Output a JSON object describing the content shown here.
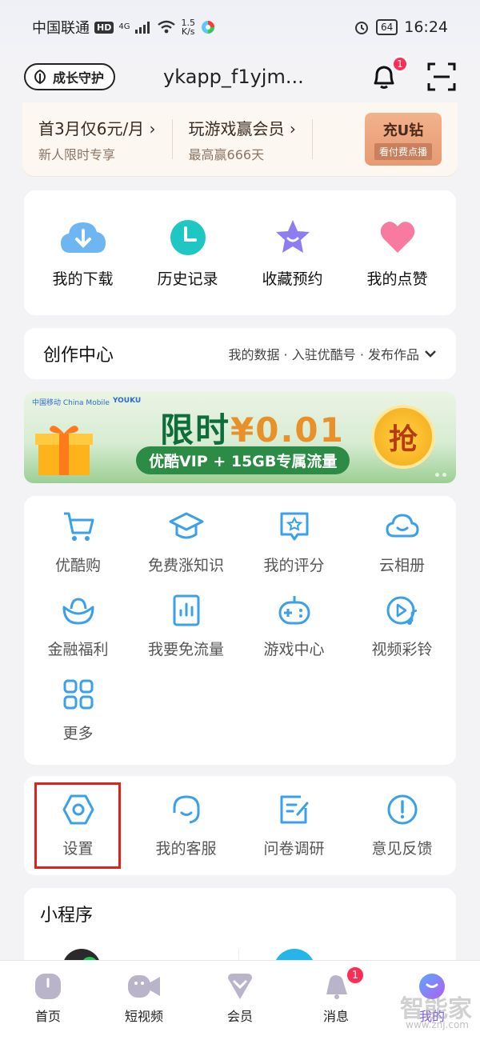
{
  "status_bar": {
    "carrier": "中国联通",
    "hd": "HD",
    "network": "4G",
    "speed": "1.5\nK/s",
    "battery": "64",
    "time": "16:24"
  },
  "header": {
    "guard_label": "成长守护",
    "username": "ykapp_f1yjm...",
    "notification_count": "1"
  },
  "promo": {
    "item1_title": "首3月仅6元/月",
    "item1_sub": "新人限时专享",
    "item2_title": "玩游戏赢会员",
    "item2_sub": "最高赢666天",
    "ucoin_label": "充U钻",
    "ucoin_sub": "看付费点播"
  },
  "quick_actions": [
    {
      "label": "我的下载",
      "icon": "download-cloud-icon"
    },
    {
      "label": "历史记录",
      "icon": "clock-icon"
    },
    {
      "label": "收藏预约",
      "icon": "star-icon"
    },
    {
      "label": "我的点赞",
      "icon": "heart-icon"
    }
  ],
  "create_center": {
    "title": "创作中心",
    "links": "我的数据 · 入驻优酷号 · 发布作品"
  },
  "banner": {
    "brand1": "中国移动 China Mobile",
    "brand2": "YOUKU",
    "headline": "限时",
    "price": "¥0.01",
    "subline": "优酷VIP + 15GB专属流量",
    "grab": "抢"
  },
  "services": [
    {
      "label": "优酷购",
      "icon": "shopping-cart-icon"
    },
    {
      "label": "免费涨知识",
      "icon": "graduation-cap-icon"
    },
    {
      "label": "我的评分",
      "icon": "rating-icon"
    },
    {
      "label": "云相册",
      "icon": "cloud-icon"
    },
    {
      "label": "金融福利",
      "icon": "gold-ingot-icon"
    },
    {
      "label": "我要免流量",
      "icon": "data-bars-icon"
    },
    {
      "label": "游戏中心",
      "icon": "gamepad-icon"
    },
    {
      "label": "视频彩铃",
      "icon": "video-music-icon"
    },
    {
      "label": "更多",
      "icon": "grid-more-icon"
    }
  ],
  "tools": [
    {
      "label": "设置",
      "icon": "settings-hexagon-icon"
    },
    {
      "label": "我的客服",
      "icon": "headset-icon"
    },
    {
      "label": "问卷调研",
      "icon": "survey-edit-icon"
    },
    {
      "label": "意见反馈",
      "icon": "exclamation-icon"
    }
  ],
  "mini_programs": {
    "title": "小程序"
  },
  "tabbar": [
    {
      "label": "首页"
    },
    {
      "label": "短视频"
    },
    {
      "label": "会员"
    },
    {
      "label": "消息",
      "badge": "1"
    },
    {
      "label": "我的",
      "active": true
    }
  ],
  "watermark": {
    "main": "智能家",
    "sub": "www.znj.com"
  },
  "colors": {
    "accent_blue": "#3aa0e8",
    "active_purple": "#7b5cf3",
    "badge_red": "#ff2d55",
    "highlight_red": "#e0201b"
  }
}
